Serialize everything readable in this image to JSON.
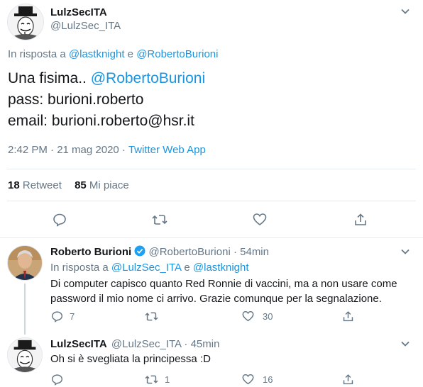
{
  "main_tweet": {
    "display_name": "LulzSecITA",
    "handle": "@LulzSec_ITA",
    "reply_prefix": "In risposta a",
    "reply_user1": "@lastknight",
    "reply_and": "e",
    "reply_user2": "@RobertoBurioni",
    "line1_text": "Una fisima..",
    "line1_mention": "@RobertoBurioni",
    "line2": "pass: burioni.roberto",
    "line3": "email: burioni.roberto@hsr.it",
    "time": "2:42 PM · 21 mag 2020 ·",
    "source": "Twitter Web App",
    "retweet_count": "18",
    "retweet_label": "Retweet",
    "like_count": "85",
    "like_label": "Mi piace"
  },
  "reply1": {
    "display_name": "Roberto Burioni",
    "handle": "@RobertoBurioni",
    "time": "· 54min",
    "reply_prefix": "In risposta a",
    "reply_user1": "@LulzSec_ITA",
    "reply_and": "e",
    "reply_user2": "@lastknight",
    "text_line1": "Di computer capisco quanto Red Ronnie di vaccini, ma a non usare come",
    "text_line2": "password il mio nome ci arrivo. Grazie comunque per la segnalazione.",
    "reply_count": "7",
    "retweet_count": "",
    "like_count": "30"
  },
  "reply2": {
    "display_name": "LulzSecITA",
    "handle": "@LulzSec_ITA",
    "time": "· 45min",
    "text": "Oh si è svegliata la principessa :D",
    "reply_count": "",
    "retweet_count": "1",
    "like_count": "16"
  },
  "colors": {
    "accent": "#1b95e0",
    "secondary": "#657786",
    "verified": "#1da1f2"
  }
}
